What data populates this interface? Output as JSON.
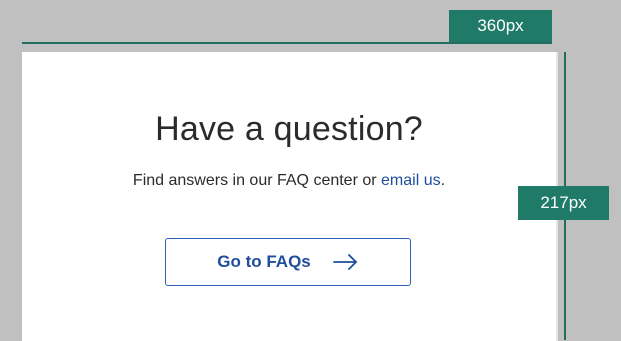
{
  "spec": {
    "width_label": "360px",
    "height_label": "217px"
  },
  "card": {
    "title": "Have a question?",
    "subtitle_prefix": "Find answers in our FAQ center or ",
    "email_link": "email us",
    "subtitle_suffix": ".",
    "button_label": "Go to FAQs"
  },
  "colors": {
    "annotation": "#1f7a68",
    "link": "#1f4d9c",
    "background": "#c0c0c0"
  },
  "icons": {
    "button_icon": "arrow-right-icon"
  }
}
